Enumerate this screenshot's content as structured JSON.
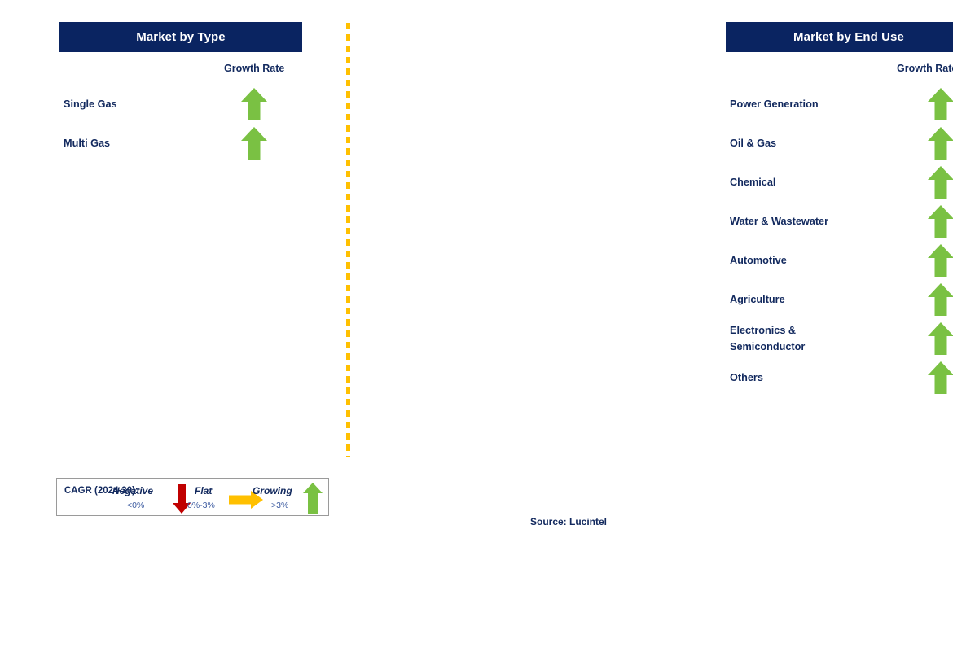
{
  "colors": {
    "header_bg": "#0a2461",
    "header_text": "#ffffff",
    "label_navy": "#12295e",
    "arrow_green": "#7ac143",
    "arrow_red": "#c00000",
    "arrow_yellow": "#ffc000",
    "divider_orange": "#ffc000",
    "legend_border": "#9a9a9a"
  },
  "sections": [
    {
      "id": "type",
      "title": "Market by Type",
      "growth_rate_label": "Growth Rate",
      "rows": [
        {
          "label": "Single Gas",
          "growth": "growing",
          "icon": "up-arrow-icon"
        },
        {
          "label": "Multi Gas",
          "growth": "growing",
          "icon": "up-arrow-icon"
        }
      ]
    },
    {
      "id": "enduse",
      "title": "Market by End Use",
      "growth_rate_label": "Growth Rate",
      "rows": [
        {
          "label": "Power Generation",
          "growth": "growing",
          "icon": "up-arrow-icon"
        },
        {
          "label": "Oil & Gas",
          "growth": "growing",
          "icon": "up-arrow-icon"
        },
        {
          "label": "Chemical",
          "growth": "growing",
          "icon": "up-arrow-icon"
        },
        {
          "label": "Water & Wastewater",
          "growth": "growing",
          "icon": "up-arrow-icon"
        },
        {
          "label": "Automotive",
          "growth": "growing",
          "icon": "up-arrow-icon"
        },
        {
          "label": "Agriculture",
          "growth": "growing",
          "icon": "up-arrow-icon"
        },
        {
          "label": "Electronics &\nSemiconductor",
          "growth": "growing",
          "icon": "up-arrow-icon"
        },
        {
          "label": "Others",
          "growth": "growing",
          "icon": "up-arrow-icon"
        }
      ]
    }
  ],
  "legend": {
    "cagr_label": "CAGR\n(2024-30):",
    "entries": [
      {
        "term": "Negative",
        "range": "<0%",
        "icon": "down-arrow-icon"
      },
      {
        "term": "Flat",
        "range": "0%-3%",
        "icon": "right-arrow-icon"
      },
      {
        "term": "Growing",
        "range": ">3%",
        "icon": "up-arrow-icon"
      }
    ]
  },
  "source": "Source: Lucintel"
}
